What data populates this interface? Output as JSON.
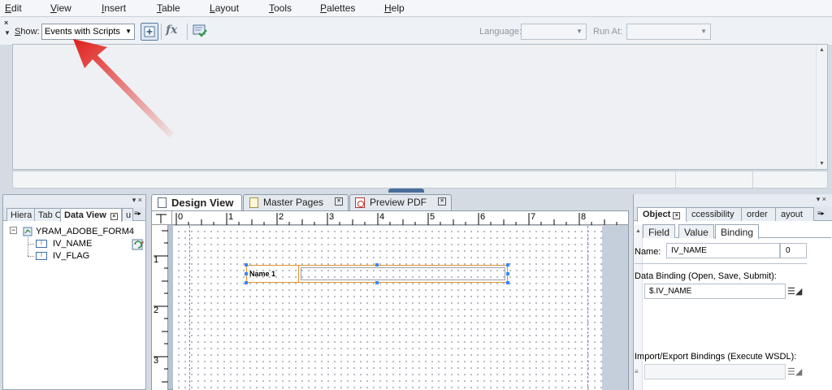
{
  "menu": {
    "items": [
      "Edit",
      "View",
      "Insert",
      "Table",
      "Layout",
      "Tools",
      "Palettes",
      "Help"
    ]
  },
  "script_toolbar": {
    "show_label": "Show:",
    "show_value": "Events with Scripts",
    "language_label": "Language:",
    "language_value": "",
    "run_at_label": "Run At:",
    "run_at_value": "",
    "icons": [
      "insert-script-object-icon",
      "function-fx-icon",
      "check-script-syntax-icon"
    ]
  },
  "left_palette": {
    "tabs": [
      "Hiera",
      "Tab O",
      "Data View",
      "u"
    ],
    "active_tab": "Data View",
    "tree": {
      "root": "YRAM_ADOBE_FORM4",
      "children": [
        "IV_NAME",
        "IV_FLAG"
      ]
    }
  },
  "design": {
    "tabs": [
      "Design View",
      "Master Pages",
      "Preview PDF"
    ],
    "active_tab": "Design View",
    "ruler_h": [
      "0",
      "1",
      "2",
      "3",
      "4",
      "5",
      "6",
      "7",
      "8"
    ],
    "ruler_v": [
      "1",
      "2",
      "3"
    ],
    "field_caption": "Name 1"
  },
  "object_palette": {
    "tabs": [
      "Object",
      "Accessibility",
      "Border",
      "Layout"
    ],
    "tab_display": [
      "Object",
      "ccessibility",
      "order",
      "ayout"
    ],
    "active_tab": "Object",
    "subtabs": [
      "Field",
      "Value",
      "Binding"
    ],
    "active_subtab": "Binding",
    "name_label": "Name:",
    "name_value": "IV_NAME",
    "name_index": "0",
    "data_binding_label": "Data Binding (Open, Save, Submit):",
    "data_binding_value": "$.IV_NAME",
    "import_export_label": "Import/Export Bindings (Execute WSDL):",
    "import_export_value": ""
  },
  "colors": {
    "annotation_arrow": "#e0201c",
    "field_border": "#e0932f",
    "selection_handle": "#3a86ff",
    "splitter": "#4a6e9b"
  }
}
